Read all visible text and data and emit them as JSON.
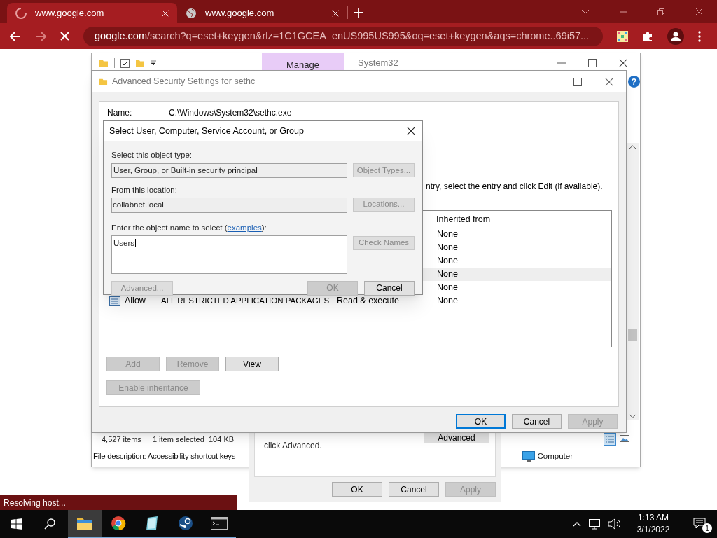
{
  "browser": {
    "tabs": [
      {
        "title": "www.google.com",
        "selected": true,
        "loading": true
      },
      {
        "title": "www.google.com",
        "selected": false,
        "loading": false
      }
    ],
    "url_host": "google.com",
    "url_path": "/search?q=eset+keygen&rlz=1C1GCEA_enUS995US995&oq=eset+keygen&aqs=chrome..69i57...",
    "loading": true,
    "status": "Resolving host..."
  },
  "explorer": {
    "help": "?",
    "ribbon_tab": "Manage",
    "title": "System32",
    "item_count": "4,527 items",
    "selection": "1 item selected  104 KB",
    "file_description": "File description: Accessibility shortcut keys",
    "location": "Computer"
  },
  "properties_dialog": {
    "note": "click Advanced.",
    "advanced_button": "Advanced",
    "buttons": [
      {
        "label": "OK",
        "disabled": false
      },
      {
        "label": "Cancel",
        "disabled": false
      },
      {
        "label": "Apply",
        "disabled": true
      }
    ]
  },
  "advanced_security": {
    "title": "Advanced Security Settings for sethc",
    "name_label": "Name:",
    "name_value": "C:\\Windows\\System32\\sethc.exe",
    "instruction": "ntry, select the entry and click Edit (if available).",
    "columns": [
      "Inherited from"
    ],
    "entries": [
      {
        "inherited_from": "None",
        "selected": false
      },
      {
        "inherited_from": "None",
        "selected": false
      },
      {
        "inherited_from": "None",
        "selected": false
      },
      {
        "inherited_from": "None",
        "selected": true
      },
      {
        "inherited_from": "None",
        "selected": false
      },
      {
        "type": "Allow",
        "principal": "ALL RESTRICTED APPLICATION PACKAGES",
        "access": "Read & execute",
        "inherited_from": "None",
        "selected": false
      }
    ],
    "action_buttons": [
      {
        "label": "Add",
        "disabled": true
      },
      {
        "label": "Remove",
        "disabled": true
      },
      {
        "label": "View",
        "disabled": false
      }
    ],
    "inheritance_button": {
      "label": "Enable inheritance",
      "disabled": true
    },
    "buttons": [
      {
        "label": "OK",
        "disabled": false,
        "focused": true
      },
      {
        "label": "Cancel",
        "disabled": false,
        "focused": false
      },
      {
        "label": "Apply",
        "disabled": true,
        "focused": false
      }
    ]
  },
  "select_dialog": {
    "title": "Select User, Computer, Service Account, or Group",
    "object_type_label": "Select this object type:",
    "object_type": "User, Group, or Built-in security principal",
    "object_types_button": "Object Types...",
    "location_label": "From this location:",
    "location": "collabnet.local",
    "locations_button": "Locations...",
    "name_label": "Enter the object name to select (",
    "name_link": "examples",
    "name_label_end": "):",
    "name_value": "Users",
    "check_names_button": "Check Names",
    "advanced_button": "Advanced...",
    "ok_button": {
      "label": "OK",
      "disabled": true
    },
    "cancel_button": {
      "label": "Cancel",
      "disabled": false
    }
  },
  "taskbar": {
    "apps": [
      {
        "kind": "explorer",
        "selected": true
      },
      {
        "kind": "chrome",
        "selected": false
      },
      {
        "kind": "notepad",
        "selected": false
      },
      {
        "kind": "steam",
        "selected": false
      },
      {
        "kind": "terminal",
        "selected": false
      }
    ],
    "time": "1:13 AM",
    "date": "3/1/2022",
    "notifications": "1"
  }
}
